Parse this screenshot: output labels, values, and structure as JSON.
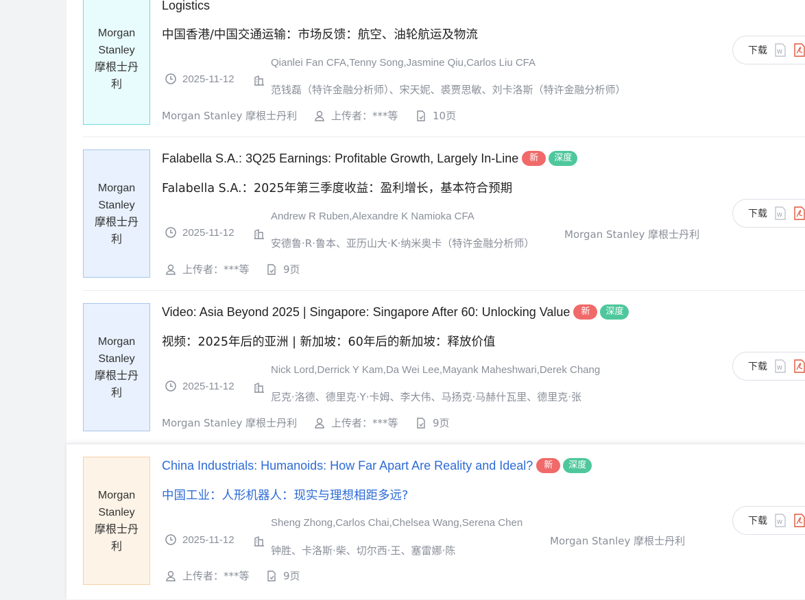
{
  "download_label": "下载",
  "badges": {
    "new": "新",
    "deep": "深度"
  },
  "colors": {
    "badge_new": "#f06a6a",
    "badge_deep": "#4fc79d",
    "link_blue": "#2d6bd5",
    "thumb_cyan_border": "#6fd7e0",
    "thumb_blue_border": "#a8c5ec",
    "thumb_orange_border": "#f5d2a8"
  },
  "reports": [
    {
      "thumb": "Morgan\nStanley\n摩根士丹\n利",
      "title_en": "Logistics",
      "title_cn": "中国香港/中国交通运输：市场反馈：航空、油轮航运及物流",
      "date": "2025-11-12",
      "authors_en": "Qianlei Fan CFA,Tenny Song,Jasmine Qiu,Carlos Liu CFA",
      "authors_cn": "范钱磊（特许金融分析师）、宋天妮、裘贾思敏、刘卡洛斯（特许金融分析师）",
      "institution": "Morgan Stanley 摩根士丹利",
      "uploader": "上传者：***等",
      "pages": "10页"
    },
    {
      "thumb": "Morgan\nStanley\n摩根士丹\n利",
      "title_en": "Falabella S.A.: 3Q25 Earnings: Profitable Growth, Largely In-Line",
      "title_cn": "Falabella S.A.：2025年第三季度收益：盈利增长，基本符合预期",
      "date": "2025-11-12",
      "authors_en": "Andrew R Ruben,Alexandre K Namioka CFA",
      "authors_cn": "安德鲁·R·鲁本、亚历山大·K·纳米奥卡（特许金融分析师）",
      "institution": "Morgan Stanley 摩根士丹利",
      "uploader": "上传者：***等",
      "pages": "9页"
    },
    {
      "thumb": "Morgan\nStanley\n摩根士丹\n利",
      "title_en": "Video: Asia Beyond 2025 | Singapore: Singapore After 60: Unlocking Value",
      "title_cn": "视频：2025年后的亚洲 | 新加坡：60年后的新加坡：释放价值",
      "date": "2025-11-12",
      "authors_en": "Nick Lord,Derrick Y Kam,Da Wei Lee,Mayank Maheshwari,Derek Chang",
      "authors_cn": "尼克·洛德、德里克·Y·卡姆、李大伟、马扬克·马赫什瓦里、德里克·张",
      "institution": "Morgan Stanley 摩根士丹利",
      "uploader": "上传者：***等",
      "pages": "9页"
    },
    {
      "thumb": "Morgan\nStanley\n摩根士丹\n利",
      "title_en": "China Industrials: Humanoids: How Far Apart Are Reality and Ideal?",
      "title_cn": "中国工业：人形机器人：现实与理想相距多远?",
      "date": "2025-11-12",
      "authors_en": "Sheng Zhong,Carlos Chai,Chelsea Wang,Serena Chen",
      "authors_cn": "钟胜、卡洛斯·柴、切尔西·王、塞雷娜·陈",
      "institution": "Morgan Stanley 摩根士丹利",
      "uploader": "上传者：***等",
      "pages": "9页"
    }
  ]
}
